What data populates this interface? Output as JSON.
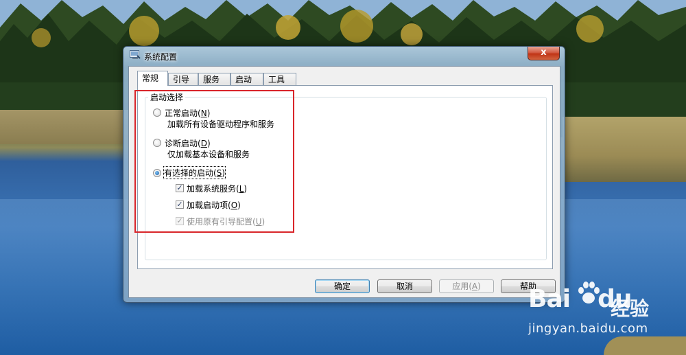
{
  "window": {
    "title": "系统配置",
    "close_symbol": "x"
  },
  "tabs": [
    {
      "label": "常规",
      "active": true
    },
    {
      "label": "引导",
      "active": false
    },
    {
      "label": "服务",
      "active": false
    },
    {
      "label": "启动",
      "active": false
    },
    {
      "label": "工具",
      "active": false
    }
  ],
  "startup_selection": {
    "group_title": "启动选择",
    "normal": {
      "label": "正常启动",
      "mnemonic": "N",
      "description": "加载所有设备驱动程序和服务",
      "selected": false
    },
    "diagnostic": {
      "label": "诊断启动",
      "mnemonic": "D",
      "description": "仅加载基本设备和服务",
      "selected": false
    },
    "selective": {
      "label": "有选择的启动",
      "mnemonic": "S",
      "selected": true
    },
    "options": {
      "load_system_services": {
        "label": "加载系统服务",
        "mnemonic": "L",
        "checked": true,
        "enabled": true
      },
      "load_startup_items": {
        "label": "加载启动项",
        "mnemonic": "O",
        "checked": true,
        "enabled": true
      },
      "use_original_boot_config": {
        "label": "使用原有引导配置",
        "mnemonic": "U",
        "checked": true,
        "enabled": false
      }
    }
  },
  "buttons": {
    "ok": "确定",
    "cancel": "取消",
    "apply": {
      "label": "应用",
      "mnemonic": "A"
    },
    "help": "帮助"
  },
  "paren_open": "(",
  "paren_close": ")",
  "check_mark": "✓",
  "watermark": {
    "logo_bai": "Bai",
    "logo_du": "du",
    "logo_cn": "经验",
    "url": "jingyan.baidu.com"
  },
  "colors": {
    "highlight_box": "#d9252a",
    "radio_selected": "#1d5fa8"
  }
}
